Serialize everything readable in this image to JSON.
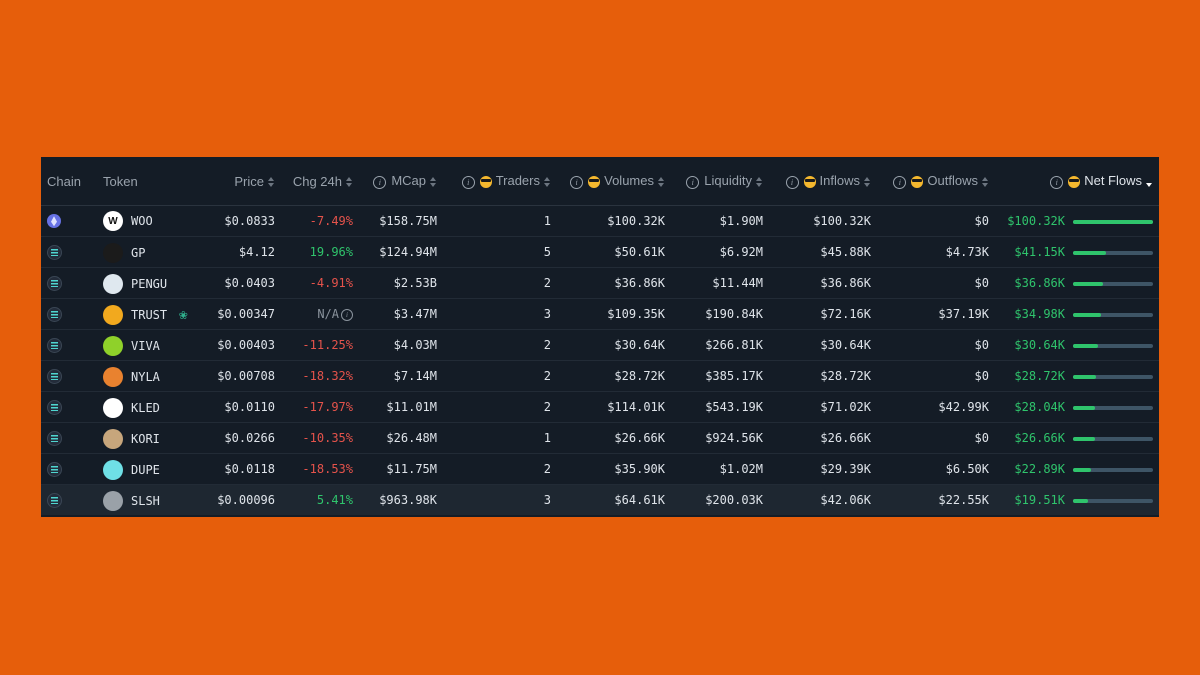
{
  "colors": {
    "background": "#e65e0b",
    "panel": "#141c26",
    "positive": "#2fc46c",
    "negative": "#e5534b"
  },
  "columns": {
    "chain": "Chain",
    "token": "Token",
    "price": "Price",
    "chg24h": "Chg 24h",
    "mcap": "MCap",
    "traders": "Traders",
    "volumes": "Volumes",
    "liquidity": "Liquidity",
    "inflows": "Inflows",
    "outflows": "Outflows",
    "netflows": "Net Flows"
  },
  "rows": [
    {
      "chain": "eth",
      "token": "WOO",
      "logo_text": "W",
      "logo_bg": "#ffffff",
      "logo_fg": "#111111",
      "price": "$0.0833",
      "chg": "-7.49%",
      "chg_dir": "neg",
      "mcap": "$158.75M",
      "traders": "1",
      "volumes": "$100.32K",
      "liquidity": "$1.90M",
      "inflows": "$100.32K",
      "outflows": "$0",
      "netflows": "$100.32K",
      "net_fraction": 1.0
    },
    {
      "chain": "sol",
      "token": "GP",
      "logo_text": "",
      "logo_bg": "#1b1b1b",
      "logo_fg": "#dddddd",
      "price": "$4.12",
      "chg": "19.96%",
      "chg_dir": "pos",
      "mcap": "$124.94M",
      "traders": "5",
      "volumes": "$50.61K",
      "liquidity": "$6.92M",
      "inflows": "$45.88K",
      "outflows": "$4.73K",
      "netflows": "$41.15K",
      "net_fraction": 0.41
    },
    {
      "chain": "sol",
      "token": "PENGU",
      "logo_text": "",
      "logo_bg": "#dfe8ef",
      "logo_fg": "#333333",
      "price": "$0.0403",
      "chg": "-4.91%",
      "chg_dir": "neg",
      "mcap": "$2.53B",
      "traders": "2",
      "volumes": "$36.86K",
      "liquidity": "$11.44M",
      "inflows": "$36.86K",
      "outflows": "$0",
      "netflows": "$36.86K",
      "net_fraction": 0.37
    },
    {
      "chain": "sol",
      "token": "TRUST",
      "logo_text": "",
      "logo_bg": "#f2a91e",
      "logo_fg": "#6b3b00",
      "price": "$0.00347",
      "chg": "N/A",
      "chg_dir": "na",
      "mcap": "$3.47M",
      "traders": "3",
      "volumes": "$109.35K",
      "liquidity": "$190.84K",
      "inflows": "$72.16K",
      "outflows": "$37.19K",
      "netflows": "$34.98K",
      "net_fraction": 0.35
    },
    {
      "chain": "sol",
      "token": "VIVA",
      "logo_text": "",
      "logo_bg": "#8fd12a",
      "logo_fg": "#ffffff",
      "price": "$0.00403",
      "chg": "-11.25%",
      "chg_dir": "neg",
      "mcap": "$4.03M",
      "traders": "2",
      "volumes": "$30.64K",
      "liquidity": "$266.81K",
      "inflows": "$30.64K",
      "outflows": "$0",
      "netflows": "$30.64K",
      "net_fraction": 0.31
    },
    {
      "chain": "sol",
      "token": "NYLA",
      "logo_text": "",
      "logo_bg": "#e9822f",
      "logo_fg": "#ffffff",
      "price": "$0.00708",
      "chg": "-18.32%",
      "chg_dir": "neg",
      "mcap": "$7.14M",
      "traders": "2",
      "volumes": "$28.72K",
      "liquidity": "$385.17K",
      "inflows": "$28.72K",
      "outflows": "$0",
      "netflows": "$28.72K",
      "net_fraction": 0.29
    },
    {
      "chain": "sol",
      "token": "KLED",
      "logo_text": "",
      "logo_bg": "#ffffff",
      "logo_fg": "#111111",
      "price": "$0.0110",
      "chg": "-17.97%",
      "chg_dir": "neg",
      "mcap": "$11.01M",
      "traders": "2",
      "volumes": "$114.01K",
      "liquidity": "$543.19K",
      "inflows": "$71.02K",
      "outflows": "$42.99K",
      "netflows": "$28.04K",
      "net_fraction": 0.28
    },
    {
      "chain": "sol",
      "token": "KORI",
      "logo_text": "",
      "logo_bg": "#c7a67c",
      "logo_fg": "#4b3220",
      "price": "$0.0266",
      "chg": "-10.35%",
      "chg_dir": "neg",
      "mcap": "$26.48M",
      "traders": "1",
      "volumes": "$26.66K",
      "liquidity": "$924.56K",
      "inflows": "$26.66K",
      "outflows": "$0",
      "netflows": "$26.66K",
      "net_fraction": 0.27
    },
    {
      "chain": "sol",
      "token": "DUPE",
      "logo_text": "",
      "logo_bg": "#6fe0e6",
      "logo_fg": "#0c2f33",
      "price": "$0.0118",
      "chg": "-18.53%",
      "chg_dir": "neg",
      "mcap": "$11.75M",
      "traders": "2",
      "volumes": "$35.90K",
      "liquidity": "$1.02M",
      "inflows": "$29.39K",
      "outflows": "$6.50K",
      "netflows": "$22.89K",
      "net_fraction": 0.23
    },
    {
      "chain": "sol",
      "token": "SLSH",
      "logo_text": "",
      "logo_bg": "#9aa1a8",
      "logo_fg": "#ffffff",
      "price": "$0.00096",
      "chg": "5.41%",
      "chg_dir": "pos",
      "mcap": "$963.98K",
      "traders": "3",
      "volumes": "$64.61K",
      "liquidity": "$200.03K",
      "inflows": "$42.06K",
      "outflows": "$22.55K",
      "netflows": "$19.51K",
      "net_fraction": 0.19
    }
  ]
}
